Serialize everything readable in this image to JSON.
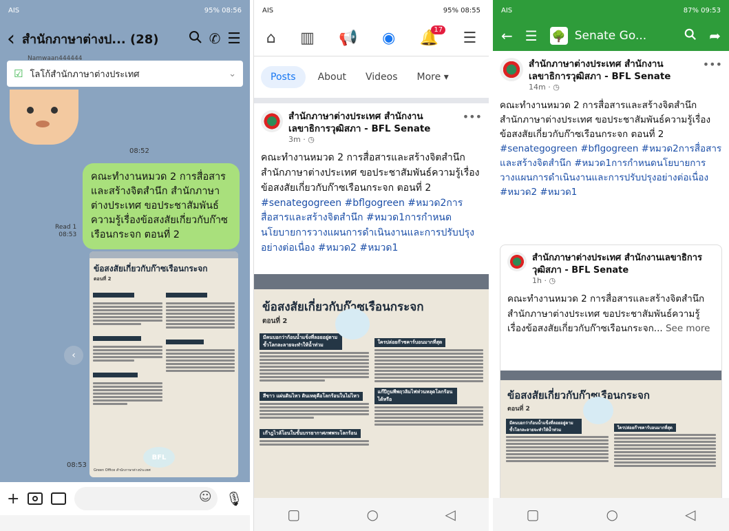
{
  "phone1": {
    "status": {
      "left": "AIS",
      "right": "95% 08:56"
    },
    "header": {
      "back": "‹",
      "title": "สำนักภาษาต่างป... (28)"
    },
    "sender": "Namwaan444444",
    "pinned": "โลโก้สำนักภาษาต่างประเทศ",
    "msg1_time": "08:52",
    "msg2_text": "คณะทำงานหมวด 2 การสื่อสารและสร้างจิตสำนึก สำนักภาษาต่างประเทศ ขอประชาสัมพันธ์ความรู้เรื่องข้อสงสัยเกี่ยวกับก๊าซเรือนกระจก ตอนที่ 2",
    "read": "Read 1",
    "read_time": "08:53",
    "img_time": "08:53",
    "poster_title": "ข้อสงสัยเกี่ยวกับก๊าซเรือนกระจก",
    "poster_sub": "ตอนที่ 2",
    "poster_badge": "BFL",
    "poster_footer": "Green Office สำนักภาษาต่างประเทศ"
  },
  "phone2": {
    "status": {
      "left": "AIS",
      "right": "95% 08:55"
    },
    "badge": "17",
    "tabs": [
      "Posts",
      "About",
      "Videos",
      "More ▾"
    ],
    "page_name": "สำนักภาษาต่างประเทศ สำนักงานเลขาธิการวุฒิสภา - BFL Senate",
    "time": "3m · ◷",
    "post_text": "คณะทำงานหมวด 2 การสื่อสารและสร้างจิตสำนึก สำนักภาษาต่างประเทศ ขอประชาสัมพันธ์ความรู้เรื่องข้อสงสัยเกี่ยวกับก๊าซเรือนกระจก ตอนที่ 2",
    "hashtags": "#senategogreen #bflgogreen #หมวด2การสื่อสารและสร้างจิตสำนึก #หมวด1การกำหนดนโยบายการวางแผนการดำเนินงานและการปรับปรุงอย่างต่อเนื่อง #หมวด2 #หมวด1",
    "poster_title": "ข้อสงสัยเกี่ยวกับก๊าซเรือนกระจก",
    "poster_sub": "ตอนที่ 2",
    "poster_q1": "มีคนบอกว่าก้อนน้ำแข็งที่ลอยอยู่ตามขั้วโลกละลายจะทำให้น้ำท่วม",
    "poster_q2": "ใครปล่อยก๊าซคาร์บอนมากที่สุด",
    "poster_q3": "สีขาว แผ่นดินไหว ดินเหตุคือโลกร้อนในไม่ไหว",
    "poster_q4": "แก๊ปีกูนพีพฤวลิมไฟห่วนหลุดโลกร้อนได้หรือ",
    "poster_q5": "เก๊าฎไวล้โอนในขั้นบรรยากาศภพพระโลกร้อน"
  },
  "phone3": {
    "status": {
      "left": "AIS",
      "right": "87% 09:53"
    },
    "title": "Senate Go...",
    "page_name": "สำนักภาษาต่างประเทศ สำนักงานเลขาธิการวุฒิสภา - BFL Senate",
    "time": "14m · ◷",
    "post_text": "คณะทำงานหมวด 2 การสื่อสารและสร้างจิตสำนึก สำนักภาษาต่างประเทศ ขอประชาสัมพันธ์ความรู้เรื่องข้อสงสัยเกี่ยวกับก๊าซเรือนกระจก ตอนที่ 2",
    "hashtags": "#senategogreen #bflgogreen #หมวด2การสื่อสารและสร้างจิตสำนึก #หมวด1การกำหนดนโยบายการวางแผนการดำเนินงานและการปรับปรุงอย่างต่อเนื่อง #หมวด2 #หมวด1",
    "shared_name": "สำนักภาษาต่างประเทศ สำนักงานเลขาธิการวุฒิสภา - BFL Senate",
    "shared_time": "1h · ◷",
    "shared_text": "คณะทำงานหมวด 2 การสื่อสารและสร้างจิตสำนึก สำนักภาษาต่างประเทศ ขอประชาสัมพันธ์ความรู้เรื่องข้อสงสัยเกี่ยวกับก๊าซเรือนกระจก...",
    "see_more": " See more",
    "poster_title": "ข้อสงสัยเกี่ยวกับก๊าซเรือนกระจก",
    "poster_sub": "ตอนที่ 2",
    "poster_q1": "มีคนบอกว่าก้อนน้ำแข็งที่ลอยอยู่ตามขั้วโลกละลายจะทำให้น้ำท่วม",
    "poster_q2": "ใครปล่อยก๊าซคาร์บอนมากที่สุด"
  }
}
